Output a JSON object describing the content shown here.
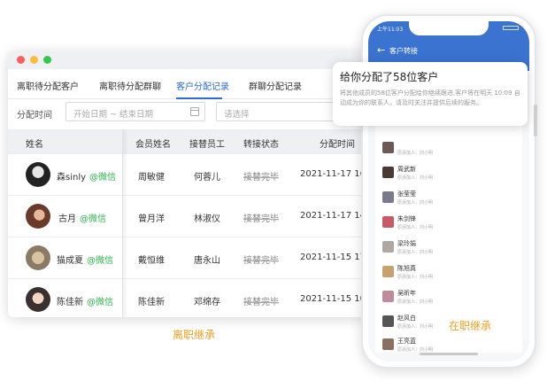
{
  "desktop": {
    "tabs": [
      {
        "label": "离职待分配客户"
      },
      {
        "label": "离职待分配群聊"
      },
      {
        "label": "客户分配记录"
      },
      {
        "label": "群聊分配记录"
      }
    ],
    "filter": {
      "label": "分配时间",
      "date_placeholder": "开始日期 ~ 结束日期",
      "select_placeholder": "请选择"
    },
    "columns": [
      "姓名",
      "会员姓名",
      "接替员工",
      "转接状态",
      "分配时间"
    ],
    "rows": [
      {
        "name": "森sinly",
        "tag": "@微信",
        "member": "周敏健",
        "successor": "何蓉儿",
        "status": "接替完毕",
        "time": "2021-11-17 16"
      },
      {
        "name": "古月",
        "tag": "@微信",
        "member": "曾月洋",
        "successor": "林淑仪",
        "status": "接替完毕",
        "time": "2021-11-17 14"
      },
      {
        "name": "猫成夏",
        "tag": "@微信",
        "member": "戴恒维",
        "successor": "唐永山",
        "status": "接替完毕",
        "time": "2021-11-15 17"
      },
      {
        "name": "陈佳新",
        "tag": "@微信",
        "member": "陈佳新",
        "successor": "邓绵存",
        "status": "接替完毕",
        "time": "2021-11-15 10"
      }
    ],
    "caption": "离职继承"
  },
  "phone": {
    "time": "上午11:03",
    "title": "客户转接",
    "list": [
      {
        "name": "",
        "sub": "原添加人：刘小明"
      },
      {
        "name": "周武新",
        "sub": "原添加人：刘小明"
      },
      {
        "name": "张莹莹",
        "sub": "原添加人：刘小明"
      },
      {
        "name": "朱剑锋",
        "sub": "原添加人：刘小明"
      },
      {
        "name": "梁玲娟",
        "sub": "原添加人：刘小明"
      },
      {
        "name": "陈旭真",
        "sub": "原添加人：刘小明"
      },
      {
        "name": "吴昕年",
        "sub": "原添加人：刘小明"
      },
      {
        "name": "赵风白",
        "sub": "原添加人：刘小明"
      },
      {
        "name": "王亮蓝",
        "sub": "原添加人：刘小明"
      }
    ],
    "caption": "在职继承"
  },
  "popup": {
    "title": "给你分配了58位客户",
    "body": "将其他成员的58位客户分配给你继续跟进,客户将在明天 10:09 自动成为你的联系人，请及时关注并提供后续的服务。"
  },
  "colors": {
    "accent": "#2f6bd4",
    "wechat_green": "#2bb24c",
    "caption_orange": "#f39c1f",
    "phone_header": "#3a73d0"
  }
}
